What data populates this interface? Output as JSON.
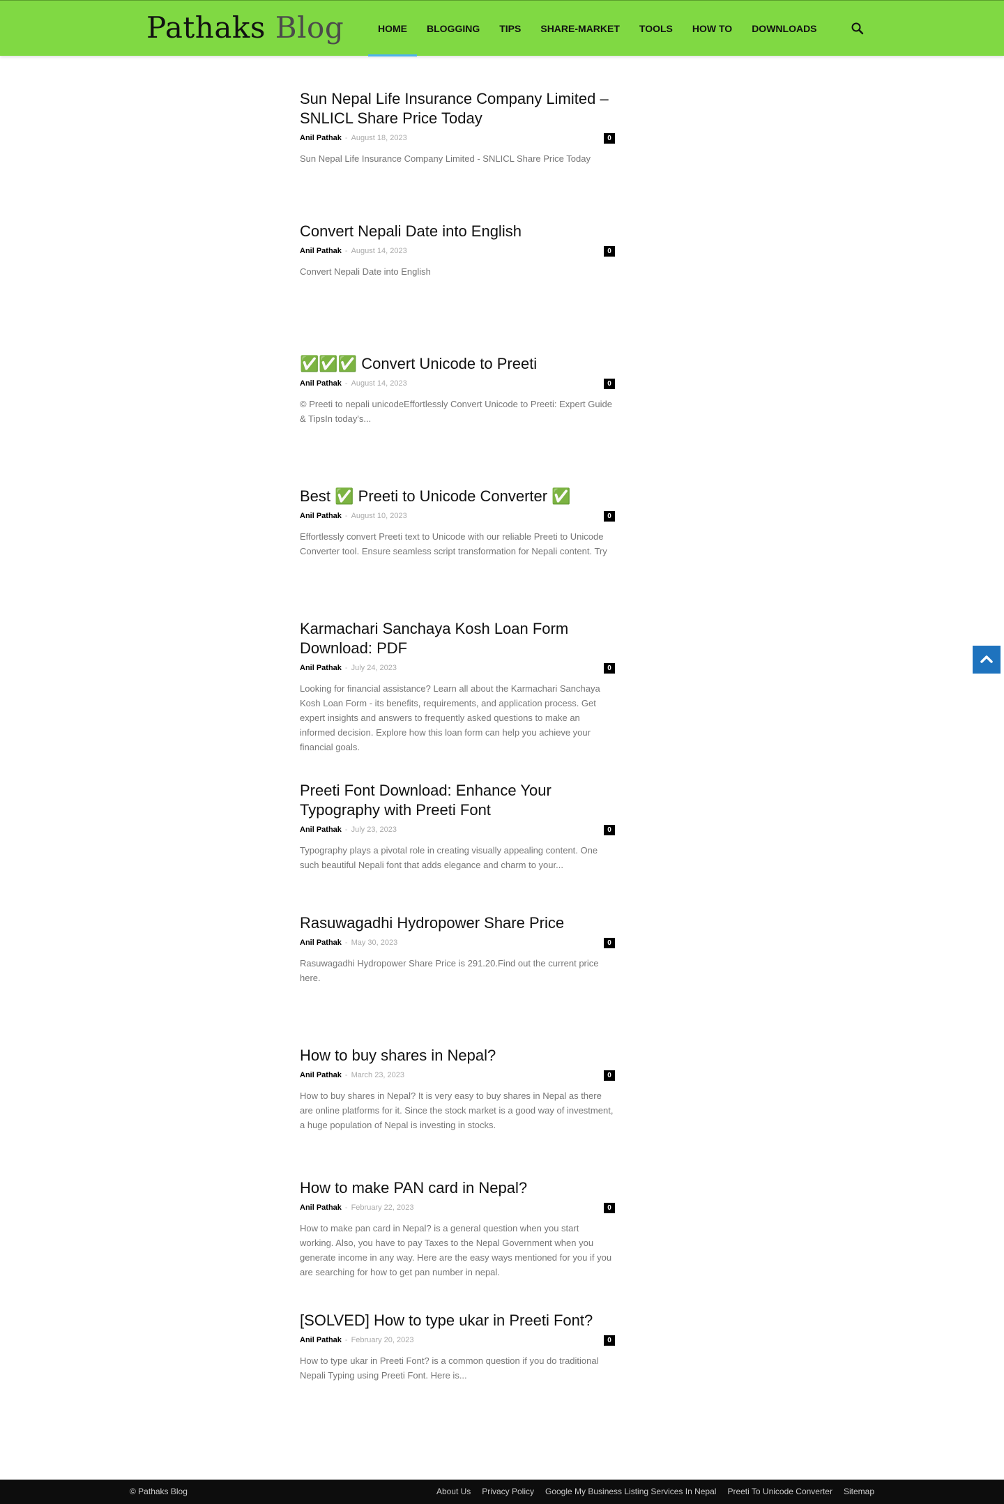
{
  "header": {
    "logo_main": "Pathaks",
    "logo_light": "Blog",
    "nav": [
      "HOME",
      "BLOGGING",
      "TIPS",
      "SHARE-MARKET",
      "TOOLS",
      "HOW TO",
      "DOWNLOADS"
    ],
    "active_nav": "HOME",
    "search_icon": "search-icon",
    "accent_color": "#80d943"
  },
  "posts": [
    {
      "title": "Sun Nepal Life Insurance Company Limited – SNLICL Share Price Today",
      "author": "Anil Pathak",
      "date": "August 18, 2023",
      "comments": "0",
      "excerpt": "Sun Nepal Life Insurance Company Limited - SNLICL Share Price Today"
    },
    {
      "title": "Convert Nepali Date into English",
      "author": "Anil Pathak",
      "date": "August 14, 2023",
      "comments": "0",
      "excerpt": "Convert Nepali Date into English"
    },
    {
      "title": "✅✅✅ Convert Unicode to Preeti",
      "author": "Anil Pathak",
      "date": "August 14, 2023",
      "comments": "0",
      "excerpt": "© Preeti to nepali unicodeEffortlessly Convert Unicode to Preeti: Expert Guide & TipsIn today's..."
    },
    {
      "title": "Best ✅ Preeti to Unicode Converter ✅",
      "author": "Anil Pathak",
      "date": "August 10, 2023",
      "comments": "0",
      "excerpt": "Effortlessly convert Preeti text to Unicode with our reliable Preeti to Unicode Converter tool. Ensure seamless script transformation for Nepali content. Try"
    },
    {
      "title": "Karmachari Sanchaya Kosh Loan Form Download: PDF",
      "author": "Anil Pathak",
      "date": "July 24, 2023",
      "comments": "0",
      "excerpt": "Looking for financial assistance? Learn all about the Karmachari Sanchaya Kosh Loan Form - its benefits, requirements, and application process. Get expert insights and answers to frequently asked questions to make an informed decision. Explore how this loan form can help you achieve your financial goals."
    },
    {
      "title": "Preeti Font Download: Enhance Your Typography with Preeti Font",
      "author": "Anil Pathak",
      "date": "July 23, 2023",
      "comments": "0",
      "excerpt": "Typography plays a pivotal role in creating visually appealing content. One such beautiful Nepali font that adds elegance and charm to your..."
    },
    {
      "title": "Rasuwagadhi Hydropower Share Price",
      "author": "Anil Pathak",
      "date": "May 30, 2023",
      "comments": "0",
      "excerpt": "Rasuwagadhi Hydropower Share Price is 291.20.Find out the current price here."
    },
    {
      "title": "How to buy shares in Nepal?",
      "author": "Anil Pathak",
      "date": "March 23, 2023",
      "comments": "0",
      "excerpt": "How to buy shares in Nepal? It is very easy to buy shares in Nepal as there are online platforms for it. Since the stock market is a good way of investment, a huge population of Nepal is investing in stocks."
    },
    {
      "title": "How to make PAN card in Nepal?",
      "author": "Anil Pathak",
      "date": "February 22, 2023",
      "comments": "0",
      "excerpt": "How to make pan card in Nepal? is a general question when you start working. Also, you have to pay Taxes to the Nepal Government when you generate income in any way. Here are the easy ways mentioned for you if you are searching for how to get pan number in nepal."
    },
    {
      "title": "[SOLVED] How to type ukar in Preeti Font?",
      "author": "Anil Pathak",
      "date": "February 20, 2023",
      "comments": "0",
      "excerpt": "How to type ukar in Preeti Font? is a common question if you do traditional Nepali Typing using Preeti Font. Here is..."
    }
  ],
  "back_to_top": {
    "icon": "chevron-up-icon",
    "color": "#1e73be"
  },
  "footer": {
    "copyright": "© Pathaks Blog",
    "links": [
      "About Us",
      "Privacy Policy",
      "Google My Business Listing Services In Nepal",
      "Preeti To Unicode Converter",
      "Sitemap"
    ]
  }
}
